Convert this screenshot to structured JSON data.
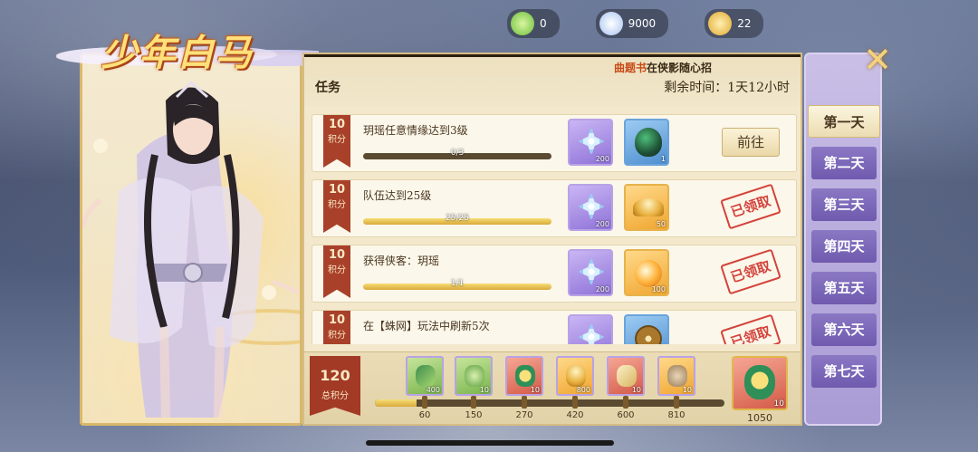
{
  "title": "少年白马",
  "subtitle_book": "曲题书",
  "subtitle_rest": "在侠影随心招",
  "tasks_label": "任务",
  "time_remaining": "剩余时间：1天12小时",
  "tasks": [
    {
      "points": "10",
      "unit": "积分",
      "name": "玥瑶任意情缘达到3级",
      "progress_text": "0/3",
      "progress": 0,
      "rewards": [
        {
          "icon": "star-crystal-icon",
          "qty": "200"
        },
        {
          "icon": "jade-pot-icon",
          "qty": "1"
        }
      ],
      "action": "前往",
      "status": "goto"
    },
    {
      "points": "10",
      "unit": "积分",
      "name": "队伍达到25级",
      "progress_text": "25/25",
      "progress": 1,
      "rewards": [
        {
          "icon": "star-crystal-icon",
          "qty": "200"
        },
        {
          "icon": "gold-ingot-icon",
          "qty": "50"
        }
      ],
      "action": "已领取",
      "status": "claimed"
    },
    {
      "points": "10",
      "unit": "积分",
      "name": "获得侠客：玥瑶",
      "progress_text": "1/1",
      "progress": 1,
      "rewards": [
        {
          "icon": "star-crystal-icon",
          "qty": "200"
        },
        {
          "icon": "fire-orb-icon",
          "qty": "100"
        }
      ],
      "action": "已领取",
      "status": "claimed"
    },
    {
      "points": "10",
      "unit": "积分",
      "name": "在【蛛网】玩法中刷新5次",
      "progress_text": "",
      "progress": 1,
      "rewards": [
        {
          "icon": "star-crystal-icon",
          "qty": ""
        },
        {
          "icon": "copper-coin-icon",
          "qty": ""
        }
      ],
      "action": "已领取",
      "status": "claimed"
    }
  ],
  "total_points": "120",
  "total_label": "总积分",
  "points_progress": 0.12,
  "milestones": [
    {
      "value": "60",
      "qty": "400",
      "icon": "jade-leaf-icon",
      "color": "r-green"
    },
    {
      "value": "150",
      "qty": "10",
      "icon": "dragon-jade-icon",
      "color": "r-green"
    },
    {
      "value": "270",
      "qty": "10",
      "icon": "lucky-pouch-icon",
      "color": "r-red"
    },
    {
      "value": "420",
      "qty": "800",
      "icon": "gold-ingot-icon",
      "color": "r-orange"
    },
    {
      "value": "600",
      "qty": "10",
      "icon": "scroll-icon",
      "color": "r-red"
    },
    {
      "value": "810",
      "qty": "10",
      "icon": "ore-icon",
      "color": "r-orange"
    }
  ],
  "final_reward": {
    "value": "1050",
    "qty": "10",
    "icon": "grand-pouch-icon"
  },
  "days": [
    "第一天",
    "第二天",
    "第三天",
    "第四天",
    "第五天",
    "第六天",
    "第七天"
  ],
  "active_day": 0,
  "resources": [
    {
      "icon": "jade-currency-icon",
      "value": "0"
    },
    {
      "icon": "crystal-currency-icon",
      "value": "9000"
    },
    {
      "icon": "gold-currency-icon",
      "value": "22"
    }
  ]
}
